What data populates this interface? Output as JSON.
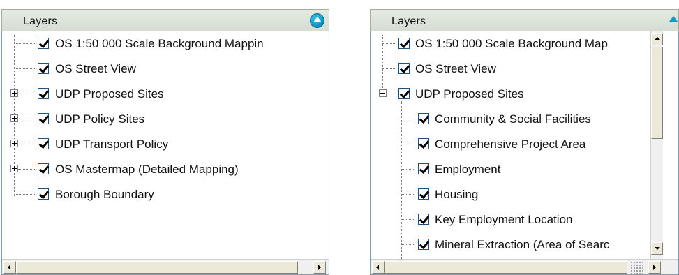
{
  "left_panel": {
    "title": "Layers",
    "layers": [
      {
        "label": "OS 1:50 000 Scale Background Mappin",
        "checked": true,
        "expandable": false
      },
      {
        "label": "OS Street View",
        "checked": true,
        "expandable": false
      },
      {
        "label": "UDP Proposed Sites",
        "checked": true,
        "expandable": true,
        "expanded": false
      },
      {
        "label": "UDP Policy Sites",
        "checked": true,
        "expandable": true,
        "expanded": false
      },
      {
        "label": "UDP Transport Policy",
        "checked": true,
        "expandable": true,
        "expanded": false
      },
      {
        "label": "OS Mastermap (Detailed Mapping)",
        "checked": true,
        "expandable": true,
        "expanded": false
      },
      {
        "label": "Borough Boundary",
        "checked": true,
        "expandable": false
      }
    ]
  },
  "right_panel": {
    "title": "Layers",
    "layers": [
      {
        "label": "OS 1:50 000 Scale Background Map",
        "checked": true,
        "expandable": false
      },
      {
        "label": "OS Street View",
        "checked": true,
        "expandable": false
      },
      {
        "label": "UDP Proposed Sites",
        "checked": true,
        "expandable": true,
        "expanded": true,
        "children": [
          {
            "label": "Community & Social Facilities",
            "checked": true
          },
          {
            "label": "Comprehensive Project Area",
            "checked": true
          },
          {
            "label": "Employment",
            "checked": true
          },
          {
            "label": "Housing",
            "checked": true
          },
          {
            "label": "Key Employment Location",
            "checked": true
          },
          {
            "label": "Mineral Extraction (Area of Searc",
            "checked": true
          }
        ]
      }
    ]
  },
  "colors": {
    "header_bg": "#dde4da",
    "collapse_button": "#1aa6d6",
    "checkbox_border": "#1c5180",
    "tree_line": "#777777"
  },
  "icons": {
    "collapse": "chevron-up-icon",
    "expand": "plus-box-icon",
    "collapse_node": "minus-box-icon",
    "check": "checkmark-icon"
  }
}
